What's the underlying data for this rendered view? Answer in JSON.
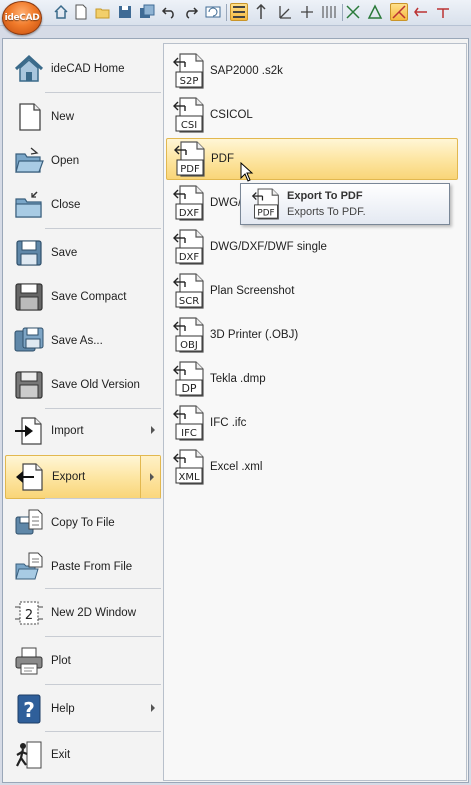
{
  "app": {
    "logo_text": "ideCAD"
  },
  "quick_access": [
    {
      "name": "home-icon"
    },
    {
      "name": "new-file-icon"
    },
    {
      "name": "open-folder-icon"
    },
    {
      "name": "save-icon"
    },
    {
      "name": "save-all-icon"
    },
    {
      "name": "undo-icon"
    },
    {
      "name": "redo-icon"
    },
    {
      "name": "refresh-icon"
    },
    {
      "name": "layers-icon"
    },
    {
      "name": "snap-icon"
    },
    {
      "name": "angle-icon"
    },
    {
      "name": "ortho-icon"
    },
    {
      "name": "grid-icon"
    },
    {
      "name": "tracking-icon"
    },
    {
      "name": "osnap-icon"
    },
    {
      "name": "cursor-icon"
    },
    {
      "name": "dimension-icon"
    },
    {
      "name": "measure-icon"
    }
  ],
  "left_menu": [
    {
      "label": "ideCAD Home",
      "icon": "home-icon"
    },
    {
      "label": "New",
      "icon": "new-file-icon"
    },
    {
      "label": "Open",
      "icon": "open-folder-icon"
    },
    {
      "label": "Close",
      "icon": "close-folder-icon"
    },
    {
      "label": "Save",
      "icon": "save-icon"
    },
    {
      "label": "Save Compact",
      "icon": "save-compact-icon"
    },
    {
      "label": "Save As...",
      "icon": "save-as-icon"
    },
    {
      "label": "Save Old Version",
      "icon": "save-old-version-icon"
    },
    {
      "label": "Import",
      "icon": "import-icon",
      "submenu": true
    },
    {
      "label": "Export",
      "icon": "export-icon",
      "submenu": true,
      "selected": true
    },
    {
      "label": "Copy To File",
      "icon": "copy-to-file-icon"
    },
    {
      "label": "Paste From File",
      "icon": "paste-from-file-icon"
    },
    {
      "label": "New 2D Window",
      "icon": "new-2d-window-icon"
    },
    {
      "label": "Plot",
      "icon": "printer-icon"
    },
    {
      "label": "Help",
      "icon": "help-icon",
      "submenu": true
    },
    {
      "label": "Exit",
      "icon": "exit-icon"
    }
  ],
  "export_menu": [
    {
      "label": "SAP2000 .s2k",
      "ext": "S2P"
    },
    {
      "label": "CSICOL",
      "ext": "CSI"
    },
    {
      "label": "PDF",
      "ext": "PDF",
      "hover": true
    },
    {
      "label": "DWG/DXF/DWF",
      "ext": "DXF"
    },
    {
      "label": "DWG/DXF/DWF single",
      "ext": "DXF"
    },
    {
      "label": "Plan Screenshot",
      "ext": "SCR"
    },
    {
      "label": "3D Printer (.OBJ)",
      "ext": "OBJ"
    },
    {
      "label": "Tekla .dmp",
      "ext": "DP"
    },
    {
      "label": "IFC .ifc",
      "ext": "IFC"
    },
    {
      "label": "Excel .xml",
      "ext": "XML"
    }
  ],
  "tooltip": {
    "title": "Export To PDF",
    "description": "Exports To PDF.",
    "ext": "PDF"
  },
  "colors": {
    "highlight": "#fde6a3",
    "highlight_border": "#e2b84f",
    "app_button": "#f07a2a"
  }
}
